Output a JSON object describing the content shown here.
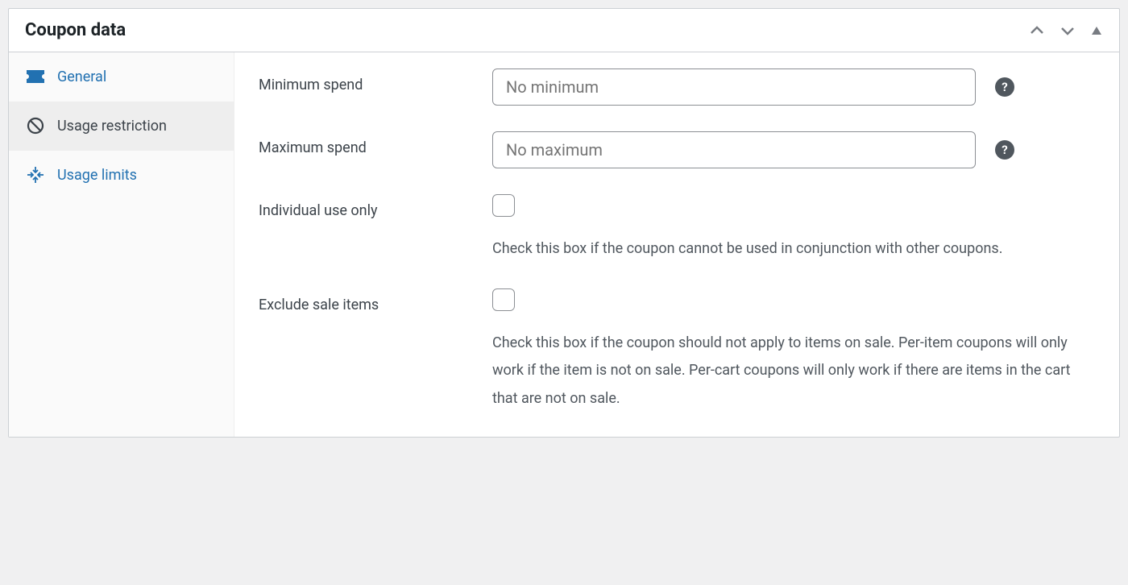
{
  "panel": {
    "title": "Coupon data"
  },
  "tabs": {
    "general": {
      "label": "General"
    },
    "usage_restriction": {
      "label": "Usage restriction"
    },
    "usage_limits": {
      "label": "Usage limits"
    }
  },
  "fields": {
    "minimum_spend": {
      "label": "Minimum spend",
      "placeholder": "No minimum",
      "value": ""
    },
    "maximum_spend": {
      "label": "Maximum spend",
      "placeholder": "No maximum",
      "value": ""
    },
    "individual_use": {
      "label": "Individual use only",
      "checked": false,
      "description": "Check this box if the coupon cannot be used in conjunction with other coupons."
    },
    "exclude_sale_items": {
      "label": "Exclude sale items",
      "checked": false,
      "description": "Check this box if the coupon should not apply to items on sale. Per-item coupons will only work if the item is not on sale. Per-cart coupons will only work if there are items in the cart that are not on sale."
    }
  },
  "help_glyph": "?"
}
